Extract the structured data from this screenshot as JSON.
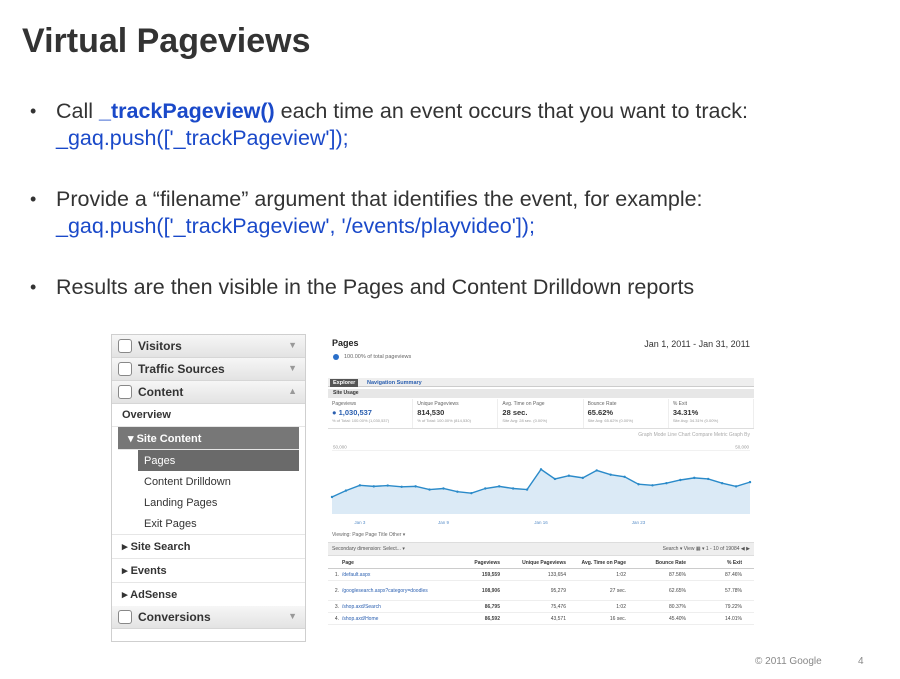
{
  "slide": {
    "title": "Virtual Pageviews",
    "bullets": [
      {
        "pre": "Call ",
        "kw": "_trackPageview()",
        "post": " each time an event occurs that you want to track:",
        "code": "_gaq.push(['_trackPageview']);"
      },
      {
        "pre": "Provide a “filename” argument that identifies the event, for example:",
        "code": "_gaq.push(['_trackPageview', '/events/playvideo']);"
      },
      {
        "pre": "Results are then visible in the Pages and Content Drilldown reports"
      }
    ],
    "footer": {
      "copyright": "© 2011 Google",
      "page": "4"
    }
  },
  "nav": {
    "groups": [
      "Visitors",
      "Traffic Sources",
      "Content"
    ],
    "overview": "Overview",
    "site_content": "▾ Site Content",
    "leaves": [
      "Pages",
      "Content Drilldown",
      "Landing Pages",
      "Exit Pages"
    ],
    "sections": [
      "▸ Site Search",
      "▸ Events",
      "▸ AdSense"
    ],
    "conversions": "Conversions"
  },
  "report": {
    "title": "Pages",
    "date_range": "Jan 1, 2011 - Jan 31, 2011",
    "pct": "100.00% of total pageviews",
    "tab_explorer": "Explorer",
    "tab_nav": "Navigation Summary",
    "subtab": "Site Usage",
    "metrics": [
      {
        "label": "Pageviews",
        "value": "● 1,030,537",
        "sub": "% of Total: 100.00% (1,030,537)"
      },
      {
        "label": "Unique Pageviews",
        "value": "814,530",
        "sub": "% of Total: 100.00% (814,530)"
      },
      {
        "label": "Avg. Time on Page",
        "value": "28 sec.",
        "sub": "Site Avg: 28 sec. (0.00%)"
      },
      {
        "label": "Bounce Rate",
        "value": "65.62%",
        "sub": "Site Avg: 65.62% (0.00%)"
      },
      {
        "label": "% Exit",
        "value": "34.31%",
        "sub": "Site Avg: 34.31% (0.00%)"
      }
    ],
    "graph_opts": "Graph Mode   Line Chart      Compare Metric      Graph By",
    "viewing": "Viewing:  Page   Page Title   Other ▾",
    "toolbar_left": "Secondary dimension:  Select... ▾",
    "toolbar_right": "Search ▾      View  ▦ ▾      1 - 10 of 19084   ◀  ▶",
    "headers": [
      "",
      "Page",
      "Pageviews",
      "Unique Pageviews",
      "Avg. Time on Page",
      "Bounce Rate",
      "% Exit"
    ],
    "rows": [
      [
        "1.",
        "/default.aspx",
        "159,559",
        "133,654",
        "1:02",
        "87.56%",
        "87.46%"
      ],
      [
        "2.",
        "/googlesearch.aspx?category=doodles",
        "108,906",
        "95,279",
        "27 sec.",
        "62.65%",
        "57.78%"
      ],
      [
        "3.",
        "/shop.axd/Search",
        "86,795",
        "75,476",
        "1:02",
        "80.37%",
        "79.22%"
      ],
      [
        "4.",
        "/shop.axd/Home",
        "86,592",
        "43,571",
        "16 sec.",
        "45.40%",
        "14.01%"
      ]
    ]
  },
  "chart_data": {
    "type": "line",
    "x": [
      "Jan 1",
      "Jan 2",
      "Jan 3",
      "Jan 4",
      "Jan 5",
      "Jan 6",
      "Jan 7",
      "Jan 8",
      "Jan 9",
      "Jan 10",
      "Jan 11",
      "Jan 12",
      "Jan 13",
      "Jan 14",
      "Jan 15",
      "Jan 16",
      "Jan 17",
      "Jan 18",
      "Jan 19",
      "Jan 20",
      "Jan 21",
      "Jan 22",
      "Jan 23",
      "Jan 24",
      "Jan 25",
      "Jan 26",
      "Jan 27",
      "Jan 28",
      "Jan 29",
      "Jan 30",
      "Jan 31"
    ],
    "tick_labels": [
      "Jan 3",
      "Jan 9",
      "Jan 16",
      "Jan 23"
    ],
    "y_tick_labels": [
      "50,000",
      "25,000"
    ],
    "series": [
      {
        "values": [
          28000,
          31000,
          33500,
          33000,
          33400,
          32800,
          33000,
          31500,
          32000,
          30500,
          29800,
          32000,
          33000,
          32000,
          31500,
          41000,
          36500,
          38000,
          37000,
          40500,
          38500,
          37500,
          34000,
          33500,
          34500,
          36000,
          37000,
          36500,
          34500,
          33000,
          35000
        ]
      }
    ],
    "ylim": [
      20000,
      52000
    ],
    "color": "#2a8ac9"
  }
}
